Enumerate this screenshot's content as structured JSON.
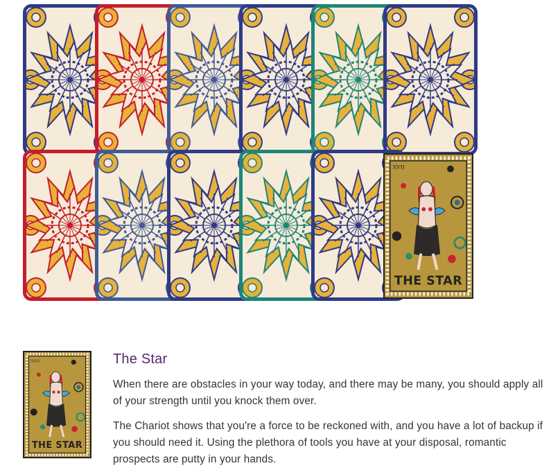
{
  "deck": {
    "rows": [
      [
        "navy",
        "red",
        "blue",
        "navy",
        "teal",
        "navy"
      ],
      [
        "red",
        "blue",
        "navy",
        "teal",
        "navy"
      ]
    ],
    "revealed_card": "The Star"
  },
  "reading": {
    "title": "The Star",
    "paragraphs": [
      "When there are obstacles in your way today, and there may be many, you should apply all of your strength until you knock them over.",
      "The Chariot shows that you're a force to be reckoned with, and you have a lot of backup if you should need it. Using the plethora of tools you have at your disposal, romantic prospects are putty in your hands."
    ]
  },
  "colors": {
    "navy": "#2e3b86",
    "red": "#c41e2c",
    "blue": "#3f5c95",
    "teal": "#1f8678",
    "gold": "#e8b23a",
    "cream": "#f6ead9",
    "title": "#54286e",
    "text": "#333333",
    "card_face": "#b8963d"
  },
  "icons": [
    "mandala-card-back-pattern",
    "star-card-illustration"
  ]
}
